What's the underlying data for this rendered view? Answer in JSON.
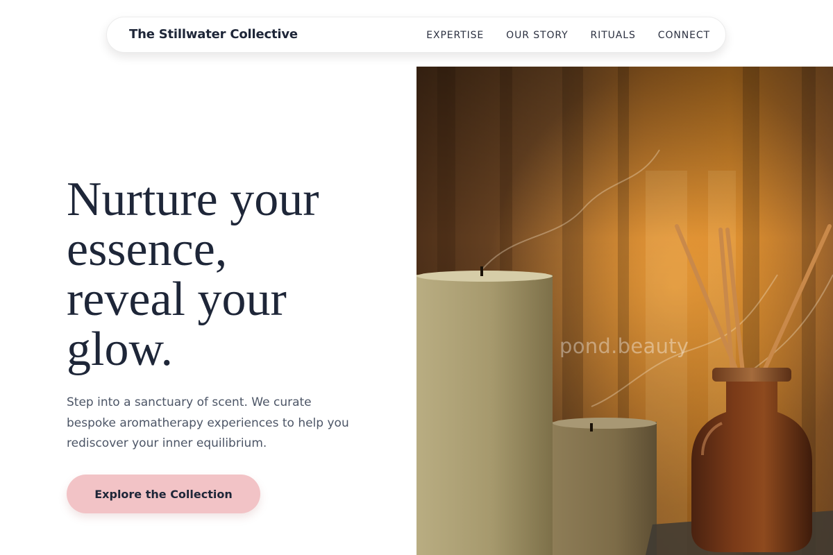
{
  "header": {
    "brand": "The Stillwater Collective",
    "nav": [
      "EXPERTISE",
      "OUR STORY",
      "RITUALS",
      "CONNECT"
    ]
  },
  "hero": {
    "headline_lines": [
      "Nurture your",
      "essence,",
      "reveal your",
      "glow."
    ],
    "description": "Step into a sanctuary of scent. We curate bespoke aromatherapy experiences to help you rediscover your inner equilibrium.",
    "cta_label": "Explore the Collection",
    "image": {
      "subject": "candles and reed diffuser with warm backlight",
      "watermark": "pond.beauty"
    }
  },
  "colors": {
    "text_dark": "#1e2638",
    "text_muted": "#4c5566",
    "cta_background": "#f2c3c6",
    "background": "#ffffff"
  }
}
